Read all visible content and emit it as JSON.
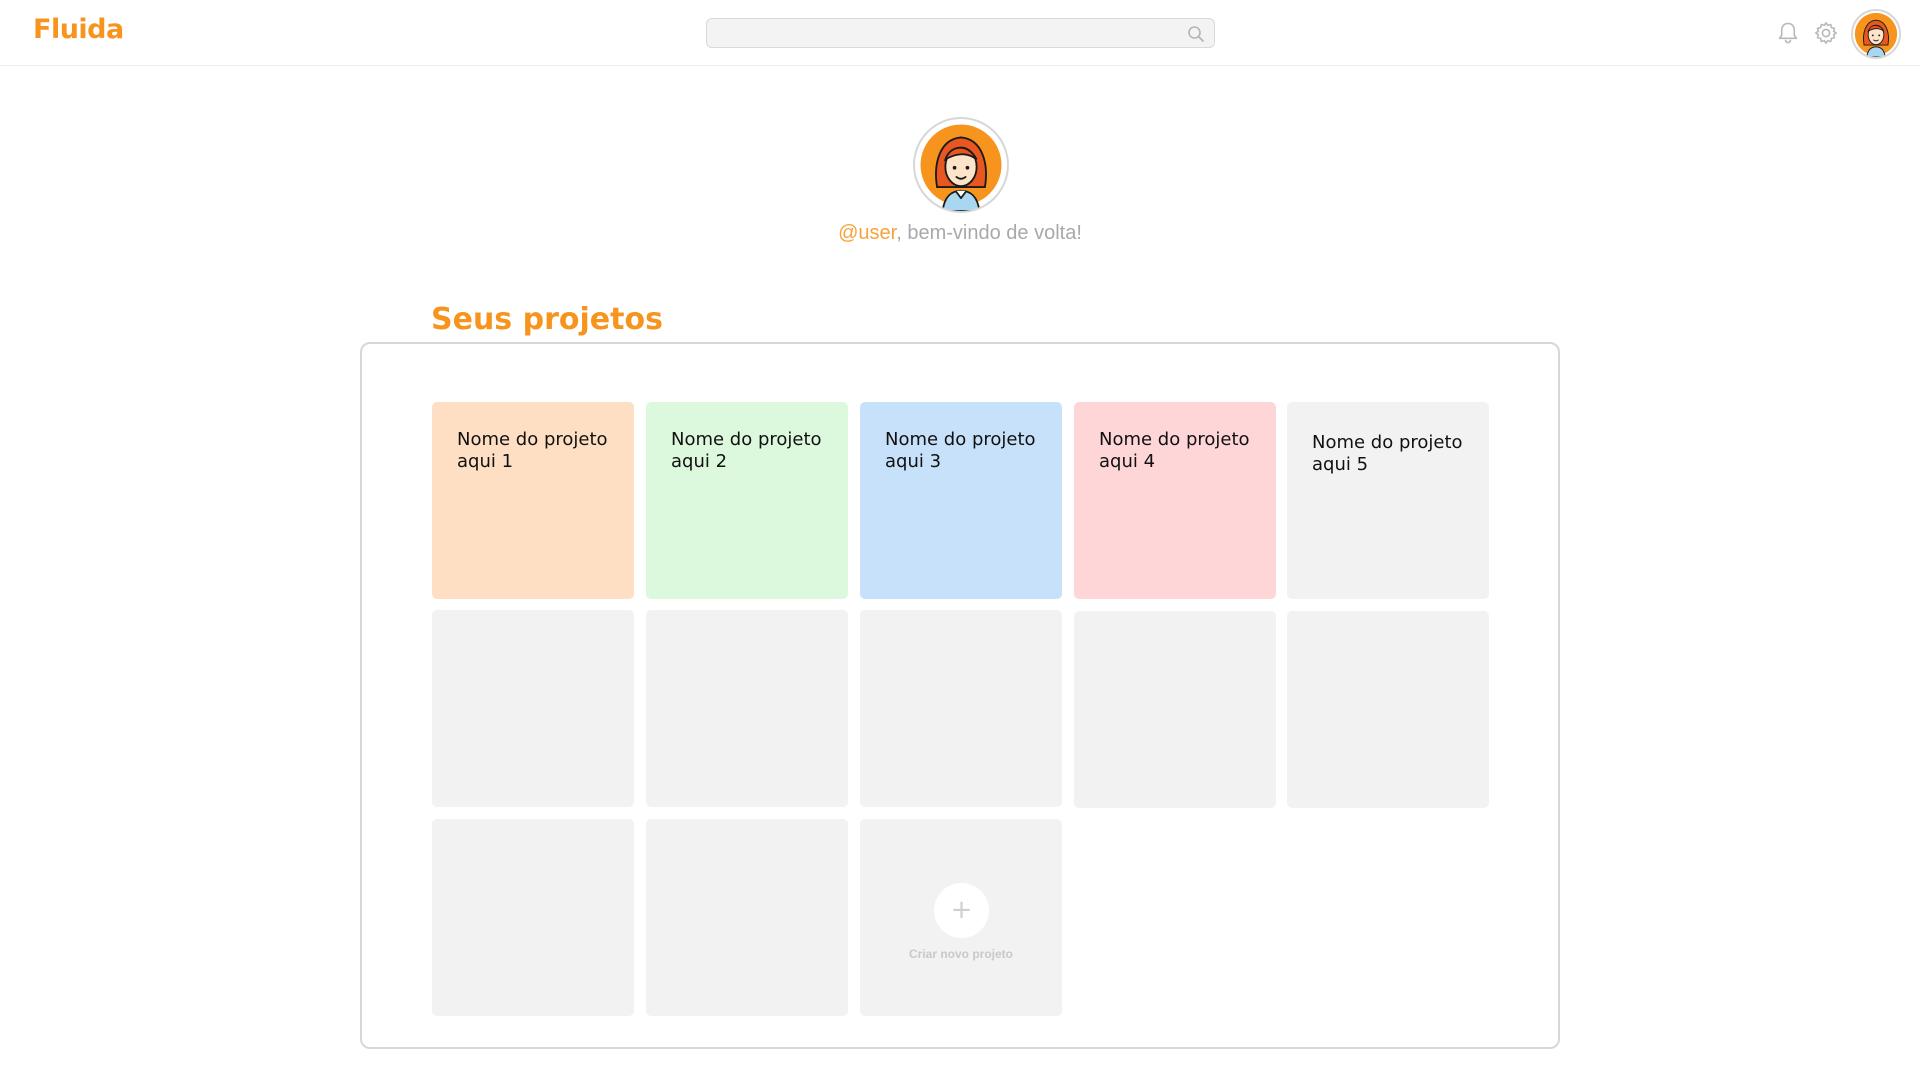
{
  "header": {
    "logo": "Fluida",
    "search": {
      "value": "",
      "placeholder": ""
    }
  },
  "profile": {
    "handle": "@user",
    "greeting": ", bem-vindo de volta!"
  },
  "projects_section": {
    "title": "Seus projetos",
    "projects": [
      {
        "name": "Nome do projeto aqui 1",
        "color": "#ffdfc3"
      },
      {
        "name": "Nome do projeto aqui 2",
        "color": "#ddf9dd"
      },
      {
        "name": "Nome do projeto aqui 3",
        "color": "#c7e1fb"
      },
      {
        "name": "Nome do projeto aqui 4",
        "color": "#ffd6d8"
      },
      {
        "name": "Nome do projeto aqui 5",
        "color": "#f2f2f2"
      }
    ],
    "create_label": "Criar novo projeto",
    "create_symbol": "+"
  },
  "colors": {
    "brand": "#f7941d",
    "placeholder_card": "#f2f2f2",
    "muted_text": "#a9a9a9"
  },
  "icons": [
    "search-icon",
    "bell-icon",
    "gear-icon",
    "avatar",
    "plus-icon"
  ]
}
